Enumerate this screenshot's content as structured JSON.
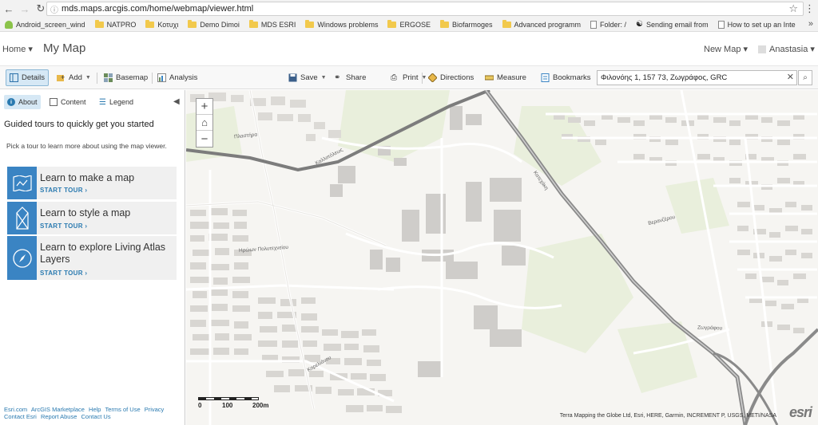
{
  "browser": {
    "url": "mds.maps.arcgis.com/home/webmap/viewer.html",
    "bookmarks": [
      {
        "label": "Android_screen_wind",
        "icon": "android"
      },
      {
        "label": "NATPRO",
        "icon": "folder"
      },
      {
        "label": "Κοτυχι",
        "icon": "folder"
      },
      {
        "label": "Demo Dimoi",
        "icon": "folder"
      },
      {
        "label": "MDS ESRI",
        "icon": "folder"
      },
      {
        "label": "Windows problems",
        "icon": "folder"
      },
      {
        "label": "ERGOSE",
        "icon": "folder"
      },
      {
        "label": "Biofarmoges",
        "icon": "folder"
      },
      {
        "label": "Advanced programm",
        "icon": "folder"
      },
      {
        "label": "Folder: /",
        "icon": "page"
      },
      {
        "label": "Sending email from",
        "icon": "swirl"
      },
      {
        "label": "How to set up an Inte",
        "icon": "page"
      }
    ],
    "more": "»"
  },
  "header": {
    "home": "Home",
    "title": "My Map",
    "new_map": "New Map",
    "user": "Anastasia"
  },
  "toolbar": {
    "details": "Details",
    "add": "Add",
    "basemap": "Basemap",
    "analysis": "Analysis",
    "save": "Save",
    "share": "Share",
    "print": "Print",
    "directions": "Directions",
    "measure": "Measure",
    "bookmarks": "Bookmarks",
    "search_value": "Φιλονόης 1, 157 73, Ζωγράφος, GRC"
  },
  "panel": {
    "tabs": {
      "about": "About",
      "content": "Content",
      "legend": "Legend"
    },
    "heading": "Guided tours to quickly get you started",
    "intro": "Pick a tour to learn more about using the map viewer.",
    "tours": [
      {
        "title": "Learn to make a map",
        "cta": "START TOUR ›",
        "icon": "map-icon"
      },
      {
        "title": "Learn to style a map",
        "cta": "START TOUR ›",
        "icon": "style-icon"
      },
      {
        "title": "Learn to explore Living Atlas Layers",
        "cta": "START TOUR ›",
        "icon": "compass-icon"
      }
    ],
    "footer": [
      "Esri.com",
      "ArcGIS Marketplace",
      "Help",
      "Terms of Use",
      "Privacy",
      "Contact Esri",
      "Report Abuse",
      "Contact Us"
    ]
  },
  "map": {
    "zoom_in": "+",
    "zoom_out": "−",
    "scale_labels": [
      "0",
      "100",
      "200m"
    ],
    "attribution": "Terra Mapping the Globe Ltd, Esri, HERE, Garmin, INCREMENT P, USGS, METI/NASA",
    "logo": "esri",
    "street_labels": [
      "Πλαστήρα",
      "Ηρώων Πολυτεχνείου",
      "Καρελιάνου",
      "Καλλιπόλεως",
      "Βερανζέρου",
      "Ζωγράφου",
      "Κατεχάκη"
    ]
  }
}
